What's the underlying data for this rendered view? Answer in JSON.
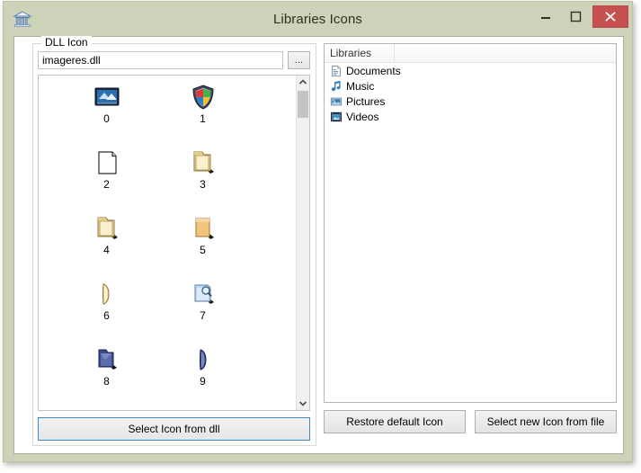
{
  "window": {
    "title": "Libraries Icons",
    "icon": "library-building-icon",
    "chrome_color": "#ccd3b9",
    "controls": {
      "minimize_label": "–",
      "minimize_name": "minimize-icon",
      "maximize_label": "□",
      "maximize_name": "maximize-icon",
      "close_label": "×",
      "close_name": "close-icon",
      "close_color": "#c75050"
    }
  },
  "dll_group": {
    "label": "DLL Icon",
    "path_value": "imageres.dll",
    "path_placeholder": "",
    "browse_label": "...",
    "select_button_label": "Select Icon from dll",
    "select_button_focus_color": "#3c8bc4"
  },
  "icon_list": {
    "icons": [
      {
        "index": "0",
        "icon": "monitor-display-icon"
      },
      {
        "index": "1",
        "icon": "security-shield-icon"
      },
      {
        "index": "2",
        "icon": "blank-document-icon"
      },
      {
        "index": "3",
        "icon": "folder-open-icon"
      },
      {
        "index": "4",
        "icon": "folder-open-icon"
      },
      {
        "index": "5",
        "icon": "folder-closed-icon"
      },
      {
        "index": "6",
        "icon": "folder-side-icon"
      },
      {
        "index": "7",
        "icon": "folder-search-icon"
      },
      {
        "index": "8",
        "icon": "blue-folder-open-icon"
      },
      {
        "index": "9",
        "icon": "blue-folder-side-icon"
      }
    ],
    "scrollbar": {
      "up_arrow": "chevron-up-icon",
      "down_arrow": "chevron-down-icon",
      "thumb_color": "#c3c3c3"
    }
  },
  "libraries_panel": {
    "column_header": "Libraries",
    "items": [
      {
        "label": "Documents",
        "icon": "documents-library-icon"
      },
      {
        "label": "Music",
        "icon": "music-library-icon"
      },
      {
        "label": "Pictures",
        "icon": "pictures-library-icon"
      },
      {
        "label": "Videos",
        "icon": "videos-library-icon"
      }
    ]
  },
  "actions": {
    "restore_default_label": "Restore default Icon",
    "select_new_from_file_label": "Select new Icon from file"
  }
}
